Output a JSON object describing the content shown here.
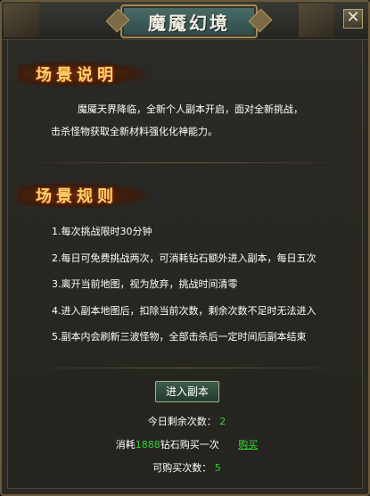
{
  "window": {
    "title": "魔魇幻境",
    "close_glyph": "✕"
  },
  "scene_desc": {
    "heading": "场景说明",
    "lines": [
      "魔魇天界降临，全新个人副本开启，面对全新挑战，",
      "击杀怪物获取全新材料强化化神能力。"
    ]
  },
  "scene_rules": {
    "heading": "场景规则",
    "items": [
      "1.每次挑战限时30分钟",
      "2.每日可免费挑战两次，可消耗钻石额外进入副本，每日五次",
      "3.离开当前地图，视为放弃，挑战时间清零",
      "4.进入副本地图后，扣除当前次数，剩余次数不足时无法进入",
      "5.副本内会刷新三波怪物，全部击杀后一定时间后副本结束"
    ]
  },
  "enter_button": {
    "label": "进入副本"
  },
  "remaining": {
    "label": "今日剩余次数：",
    "value": "2"
  },
  "purchase": {
    "prefix": "消耗",
    "cost": "1888",
    "suffix": "钻石购买一次",
    "link": "购买"
  },
  "buyable": {
    "label": "可购买次数：",
    "value": "5"
  },
  "colors": {
    "highlight_green": "#35d235",
    "heading_gold": "#ffd36b",
    "title_plate": "#4b6d6a"
  }
}
